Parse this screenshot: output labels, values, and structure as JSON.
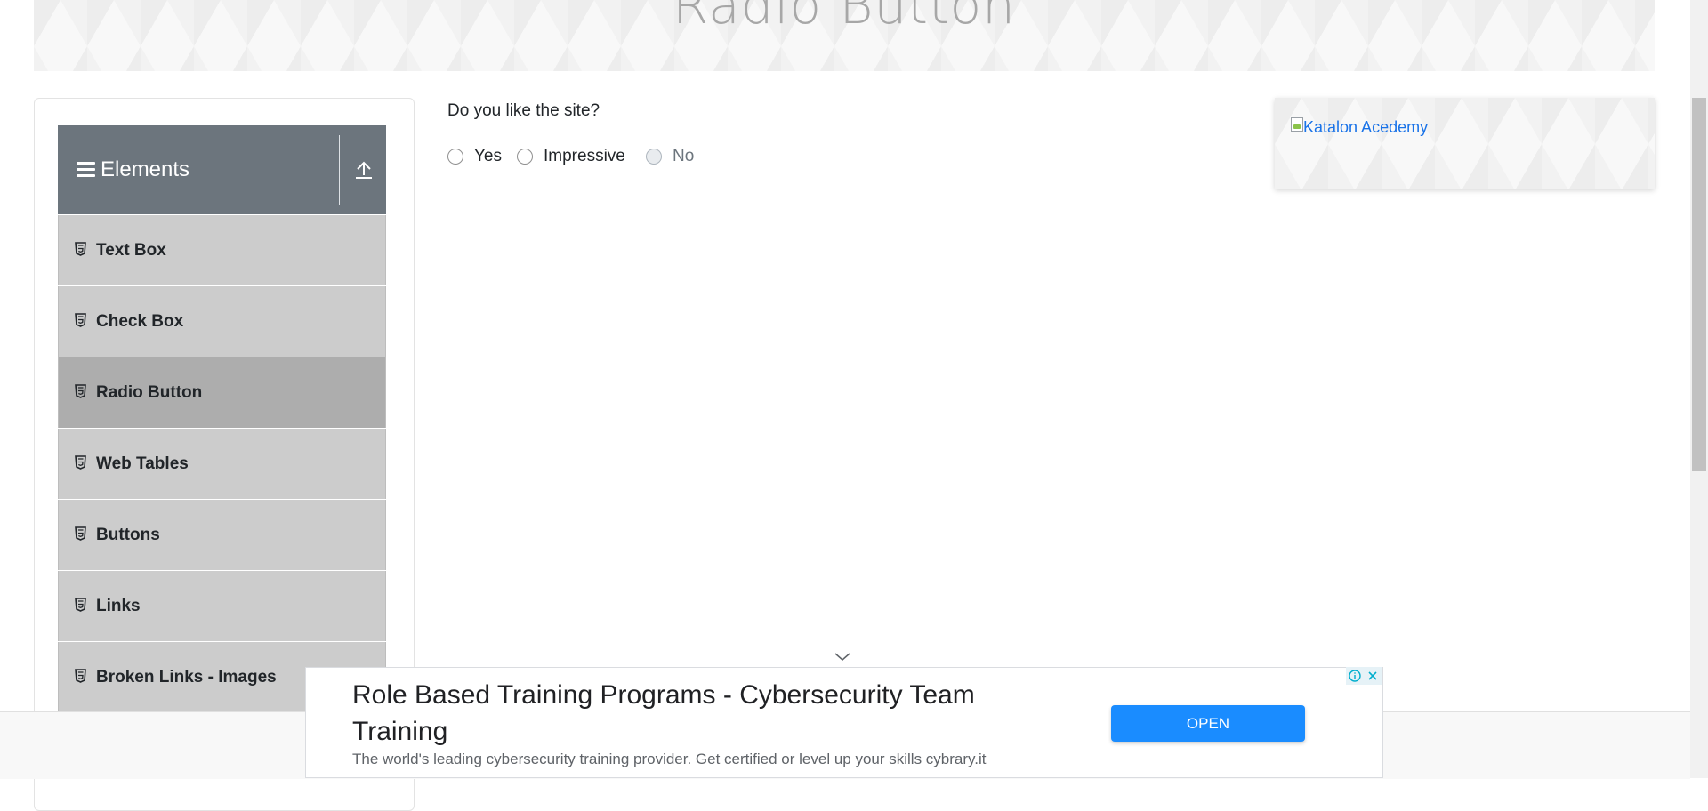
{
  "banner": {
    "title": "Radio Button"
  },
  "sidebar": {
    "group_title": "Elements",
    "items": [
      {
        "label": "Text Box"
      },
      {
        "label": "Check Box"
      },
      {
        "label": "Radio Button",
        "active": true
      },
      {
        "label": "Web Tables"
      },
      {
        "label": "Buttons"
      },
      {
        "label": "Links"
      },
      {
        "label": "Broken Links - Images"
      }
    ]
  },
  "main": {
    "question": "Do you like the site?",
    "options": [
      {
        "label": "Yes",
        "checked": false,
        "disabled": false
      },
      {
        "label": "Impressive",
        "checked": false,
        "disabled": false
      },
      {
        "label": "No",
        "checked": false,
        "disabled": true
      }
    ]
  },
  "side_ad": {
    "alt_text": "Katalon Acedemy"
  },
  "bottom_ad": {
    "headline": "Role Based Training Programs - Cybersecurity Team Training",
    "description": "The world's leading cybersecurity training provider. Get certified or level up your skills cybrary.it",
    "button_label": "OPEN"
  },
  "colors": {
    "header_bg": "#6c757d",
    "menu_item_bg": "#cccccc",
    "menu_item_active_bg": "#adadad",
    "ad_button": "#1a8cff",
    "link": "#1a73e8"
  },
  "icons": {
    "menu": "hamburger-icon",
    "collapse": "upload-arrow-icon",
    "menu_item": "html5-icon",
    "scroll_hint": "chevron-down-icon",
    "ad_info": "info-icon",
    "ad_close": "close-icon"
  }
}
